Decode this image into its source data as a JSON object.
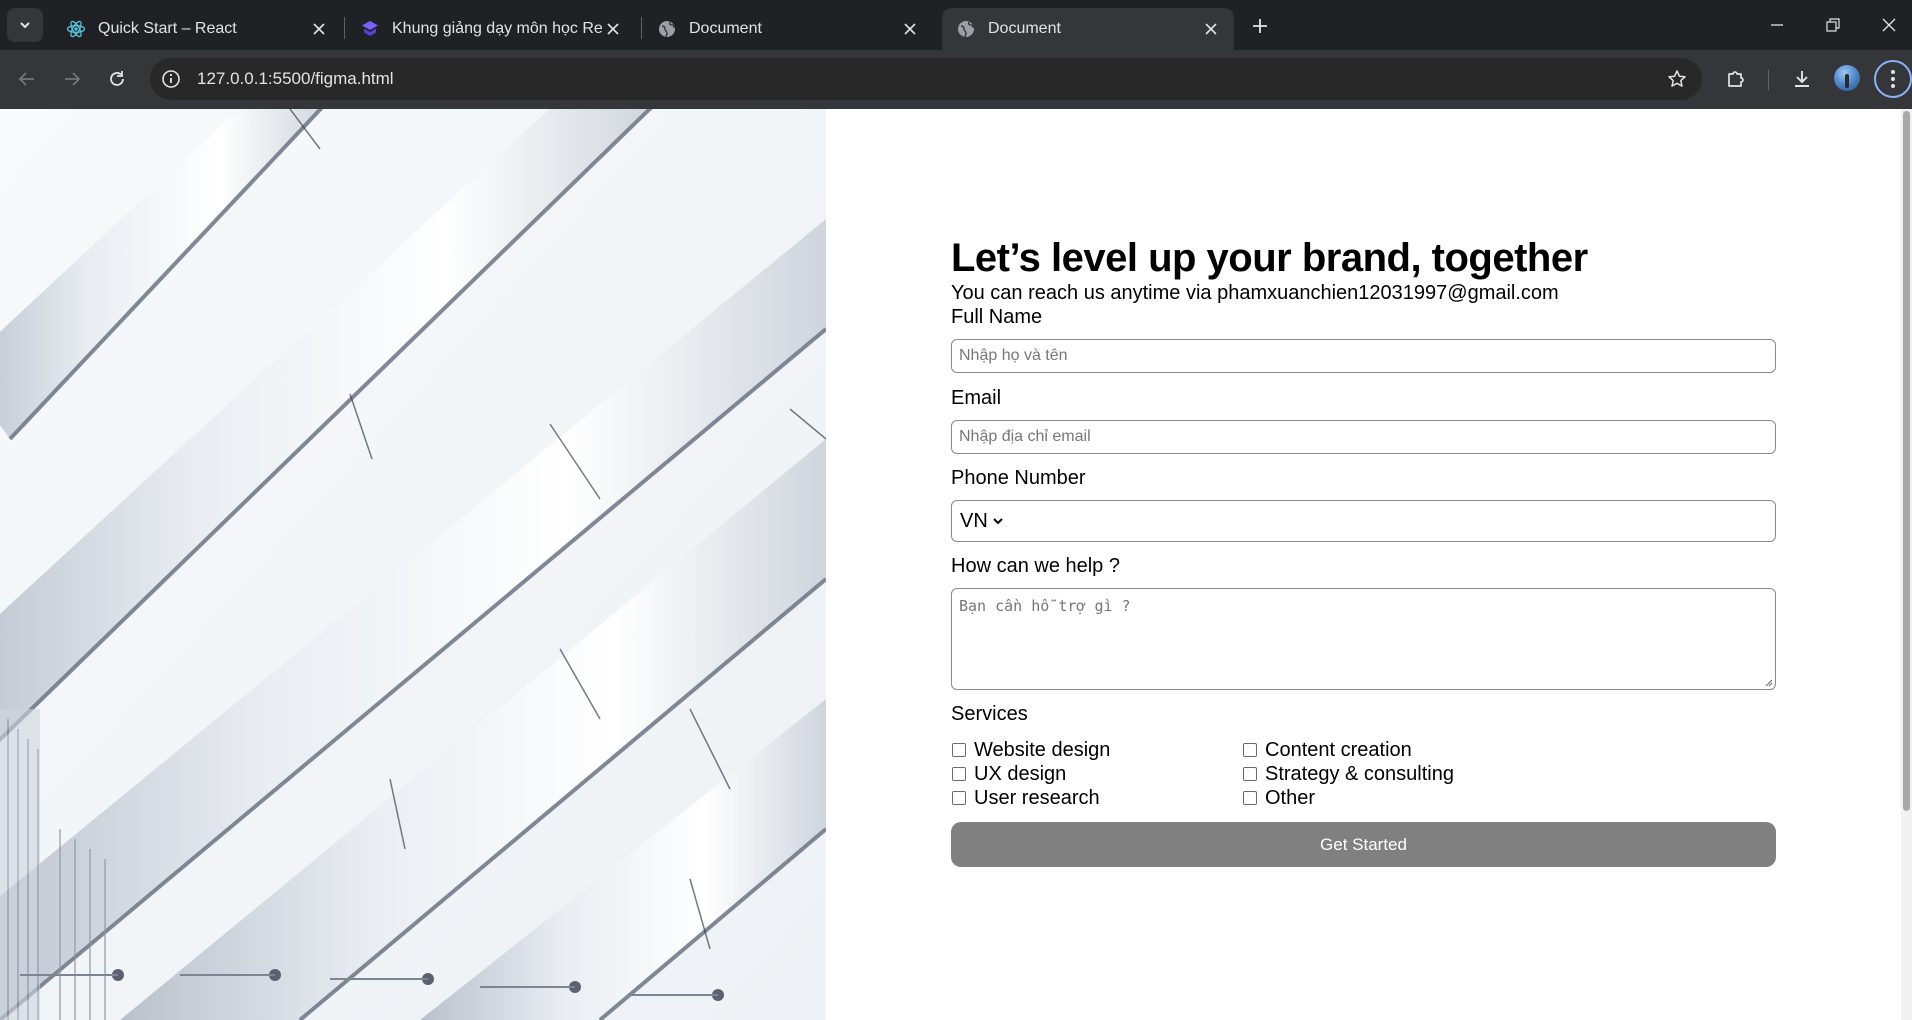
{
  "browser": {
    "tabs": [
      {
        "title": "Quick Start – React",
        "icon": "react-icon"
      },
      {
        "title": "Khung giảng dạy môn học React",
        "icon": "course-icon"
      },
      {
        "title": "Document",
        "icon": "globe-icon"
      },
      {
        "title": "Document",
        "icon": "globe-icon",
        "active": true
      }
    ],
    "url": "127.0.0.1:5500/figma.html"
  },
  "form": {
    "headline": "Let’s level up your brand, together",
    "subline": "You can reach us anytime via phamxuanchien12031997@gmail.com",
    "full_name_label": "Full Name",
    "full_name_placeholder": "Nhập họ và tên",
    "email_label": "Email",
    "email_placeholder": "Nhập địa chỉ email",
    "phone_label": "Phone Number",
    "country_code": "VN",
    "help_label": "How can we help ?",
    "help_placeholder": "Bạn cần hỗ trợ gì ?",
    "services_label": "Services",
    "services": [
      "Website design",
      "Content creation",
      "UX design",
      "Strategy & consulting",
      "User research",
      "Other"
    ],
    "submit_label": "Get Started"
  },
  "colors": {
    "button_bg": "#808080",
    "browser_dark": "#202124",
    "toolbar": "#35363a"
  }
}
